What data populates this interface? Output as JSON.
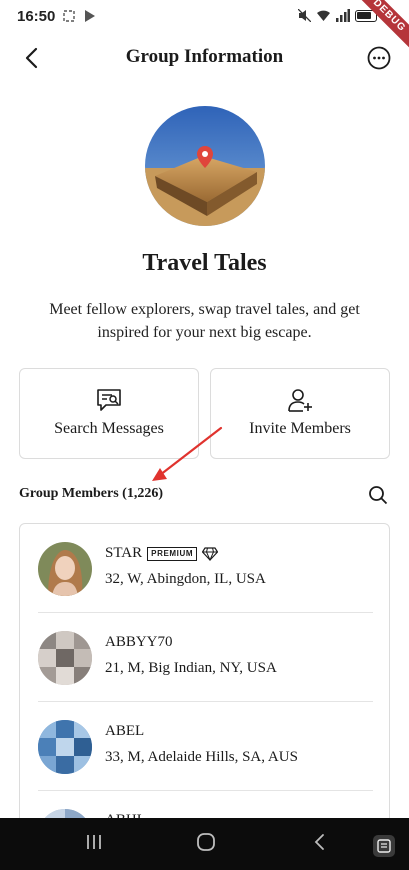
{
  "status_bar": {
    "time": "16:50"
  },
  "debug_banner": "DEBUG",
  "header": {
    "title": "Group Information"
  },
  "group": {
    "name": "Travel Tales",
    "description": "Meet fellow explorers, swap travel tales, and get inspired for your next big escape."
  },
  "actions": {
    "search_label": "Search Messages",
    "invite_label": "Invite Members"
  },
  "members": {
    "heading": "Group Members (1,226)",
    "items": [
      {
        "name": "STAR",
        "badge": "PREMIUM",
        "info": "32, W, Abingdon, IL, USA"
      },
      {
        "name": "ABBYY70",
        "info": "21, M, Big Indian, NY, USA"
      },
      {
        "name": "ABEL",
        "info": "33, M, Adelaide Hills, SA, AUS"
      },
      {
        "name": "ABHI"
      }
    ]
  },
  "colors": {
    "annotation_arrow": "#e0332e",
    "nav_bar": "#0c0c0c"
  }
}
